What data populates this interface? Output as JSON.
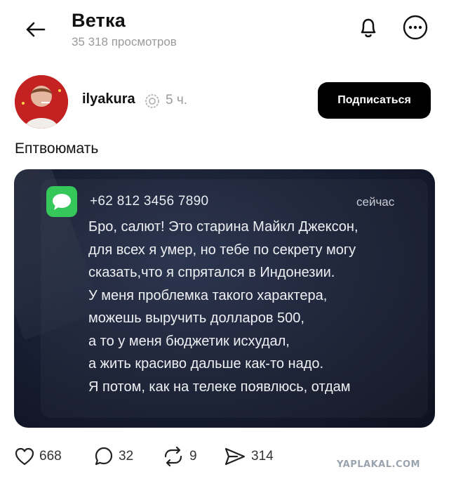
{
  "header": {
    "title": "Ветка",
    "views": "35 318 просмотров",
    "icons": {
      "back": "back-arrow-icon",
      "bell": "bell-icon",
      "more": "more-icon"
    }
  },
  "post": {
    "author": "ilyakura",
    "time": "5 ч.",
    "subscribe_label": "Подписаться",
    "text": "Ептвоюмать",
    "media": {
      "sender": "+62 812 3456 7890",
      "time": "сейчас",
      "lines": [
        "Бро, салют! Это старина Майкл Джексон,",
        "для всех я умер, но тебе по секрету могу",
        "сказать,что я спрятался в Индонезии.",
        "У меня проблемка такого характера,",
        "можешь выручить долларов 500,",
        "а то у меня бюджетик исхудал,",
        "а жить красиво дальше как-то надо.",
        "Я потом, как на телеке появлюсь, отдам"
      ]
    },
    "actions": {
      "likes": "668",
      "comments": "32",
      "reposts": "9",
      "shares": "314"
    }
  },
  "watermark": "YAPLAKAL.COM",
  "colors": {
    "button_bg": "#000000",
    "message_icon": "#35c759",
    "muted_text": "#9a9a9a"
  }
}
